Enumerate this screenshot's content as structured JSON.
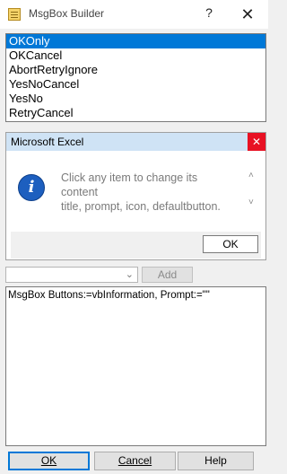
{
  "window": {
    "title": "MsgBox Builder",
    "help_glyph": "?",
    "close_glyph": "✕"
  },
  "buttons_list": {
    "items": [
      {
        "label": "OKOnly",
        "selected": true
      },
      {
        "label": "OKCancel",
        "selected": false
      },
      {
        "label": "AbortRetryIgnore",
        "selected": false
      },
      {
        "label": "YesNoCancel",
        "selected": false
      },
      {
        "label": "YesNo",
        "selected": false
      },
      {
        "label": "RetryCancel",
        "selected": false
      }
    ]
  },
  "preview": {
    "title": "Microsoft Excel",
    "icon": "information-icon",
    "message_line1": "Click any item to change its",
    "message_line2": "content",
    "message_line3": "title, prompt, icon, defaultbutton.",
    "ok_label": "OK"
  },
  "option_combo": {
    "value": ""
  },
  "add_label": "Add",
  "code_text": "MsgBox Buttons:=vbInformation, Prompt:=\"\"",
  "footer": {
    "ok": "OK",
    "cancel": "Cancel",
    "help": "Help"
  },
  "colors": {
    "selection": "#0078d7",
    "close_red": "#e81123",
    "preview_title_bg": "#cfe3f5"
  }
}
